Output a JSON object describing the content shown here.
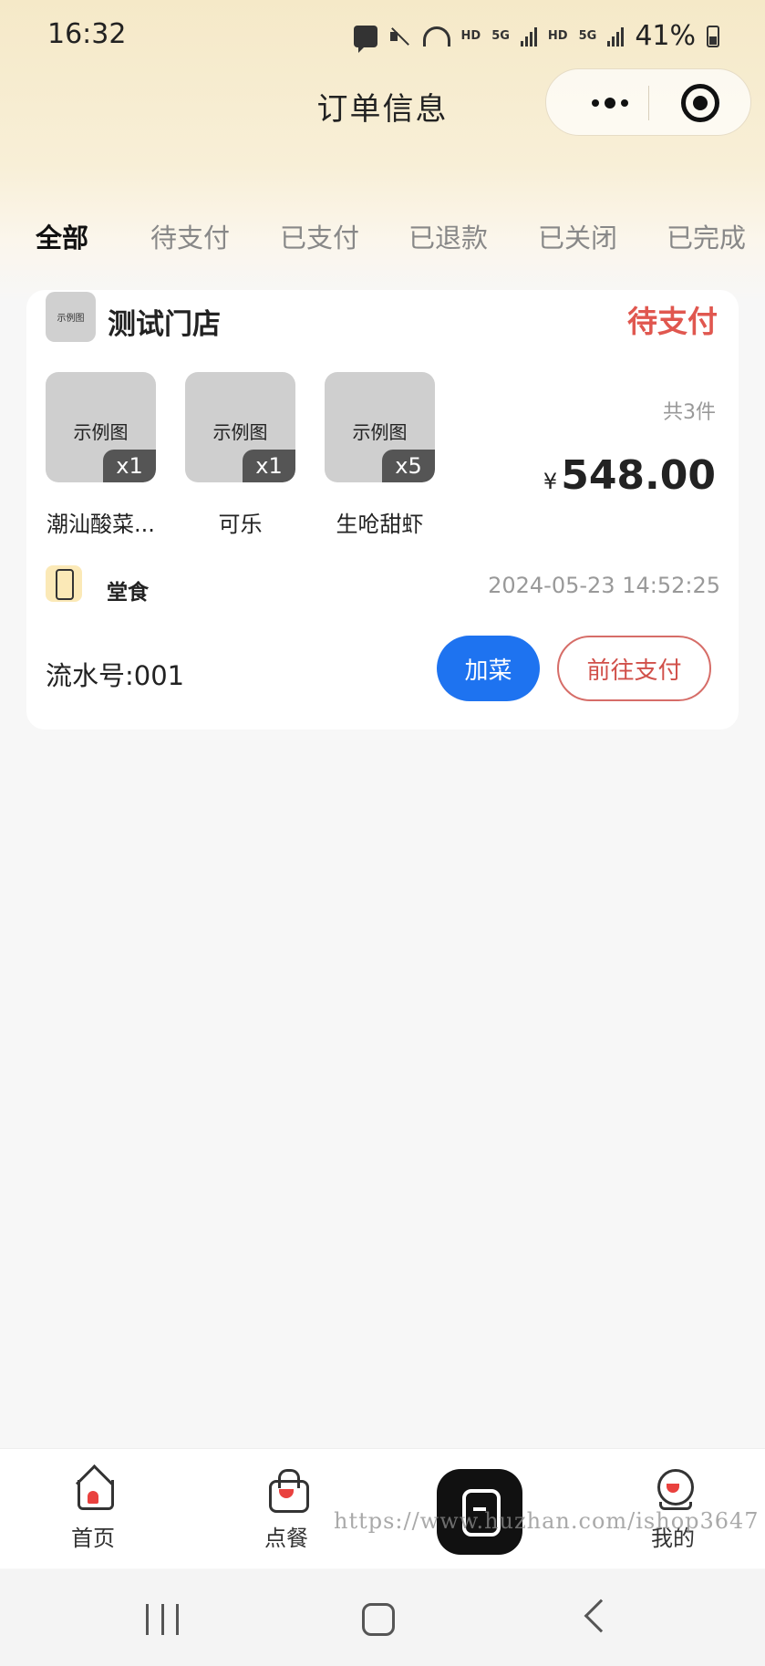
{
  "status_bar": {
    "time": "16:32",
    "hd1": "HD",
    "g1": "5G",
    "hd2": "HD",
    "g2": "5G",
    "battery": "41%"
  },
  "nav": {
    "title": "订单信息"
  },
  "tabs": [
    {
      "label": "全部",
      "active": true
    },
    {
      "label": "待支付",
      "active": false
    },
    {
      "label": "已支付",
      "active": false
    },
    {
      "label": "已退款",
      "active": false
    },
    {
      "label": "已关闭",
      "active": false
    },
    {
      "label": "已完成",
      "active": false
    }
  ],
  "order": {
    "store_logo_text": "示例图",
    "store_name": "测试门店",
    "status": "待支付",
    "items": [
      {
        "placeholder": "示例图",
        "qty": "x1",
        "name": "潮汕酸菜..."
      },
      {
        "placeholder": "示例图",
        "qty": "x1",
        "name": "可乐"
      },
      {
        "placeholder": "示例图",
        "qty": "x5",
        "name": "生呛甜虾"
      }
    ],
    "item_count": "共3件",
    "currency": "¥",
    "total": "548.00",
    "dine_type": "堂食",
    "time": "2024-05-23 14:52:25",
    "serial": "流水号:001",
    "add_button": "加菜",
    "pay_button": "前往支付"
  },
  "tabbar": {
    "home": "首页",
    "order": "点餐",
    "mine": "我的"
  },
  "watermark": "https://www.huzhan.com/ishop3647",
  "colors": {
    "accent_red": "#e0574f",
    "primary_blue": "#1e73f0",
    "header_bg": "#f5e9c8"
  }
}
